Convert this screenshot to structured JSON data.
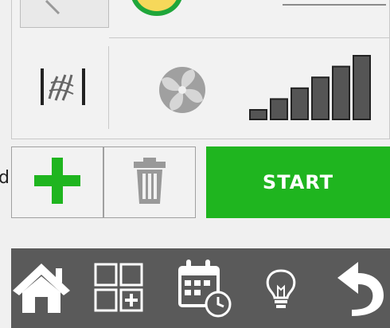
{
  "controls": {
    "start_label": "START",
    "left_edge_text": "d"
  },
  "signal": {
    "bars_total": 6,
    "bars_active": 6
  },
  "icons": {
    "filter": "filter-icon",
    "fan": "fan-icon",
    "signal": "signal-strength-icon",
    "add": "plus-icon",
    "delete": "trash-icon",
    "home": "home-icon",
    "grid": "grid-add-icon",
    "calendar": "calendar-clock-icon",
    "bulb": "lightbulb-icon",
    "back": "back-arrow-icon"
  },
  "colors": {
    "start_bg": "#1fb51f",
    "add_icon": "#1fb51f",
    "nav_bg": "#5a5a5a"
  }
}
